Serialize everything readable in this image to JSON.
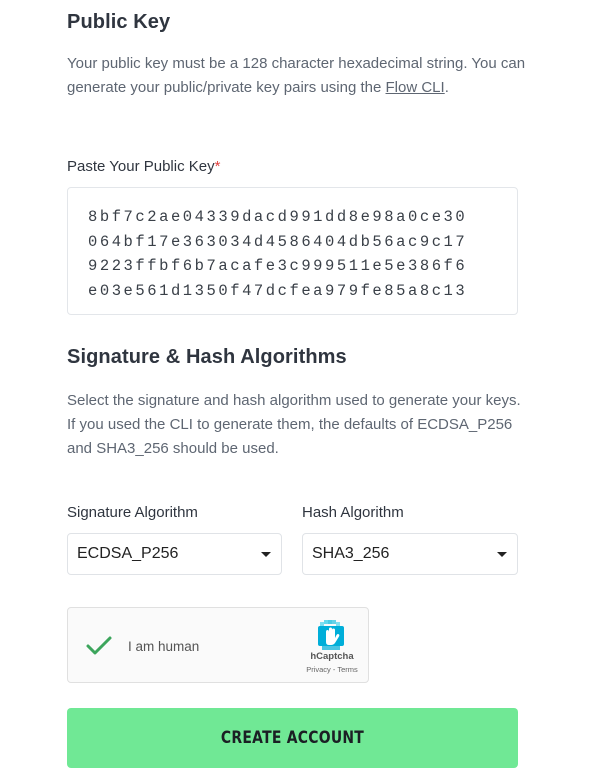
{
  "public_key": {
    "heading": "Public Key",
    "description_before_link": "Your public key must be a 128 character hexadecimal string. You can generate your public/private key pairs using the ",
    "link_text": "Flow CLI",
    "description_after_link": ".",
    "field_label": "Paste Your Public Key",
    "required_mark": "*",
    "value_lines": [
      "8bf7c2ae04339dacd991dd8e98a0ce30",
      "064bf17e363034d4586404db56ac9c17",
      "9223ffbf6b7acafe3c999511e5e386f6",
      "e03e561d1350f47dcfea979fe85a8c13"
    ]
  },
  "algorithms": {
    "heading": "Signature & Hash Algorithms",
    "description": "Select the signature and hash algorithm used to generate your keys. If you used the CLI to generate them, the defaults of ECDSA_P256 and SHA3_256 should be used.",
    "signature_label": "Signature Algorithm",
    "signature_value": "ECDSA_P256",
    "hash_label": "Hash Algorithm",
    "hash_value": "SHA3_256"
  },
  "captcha": {
    "checkbox_label": "I am human",
    "brand": "hCaptcha",
    "terms": "Privacy - Terms",
    "checked_color": "#3ca55c",
    "logo_icon": "hcaptcha-hand-icon"
  },
  "submit": {
    "label": "CREATE ACCOUNT",
    "color": "#70e895"
  }
}
